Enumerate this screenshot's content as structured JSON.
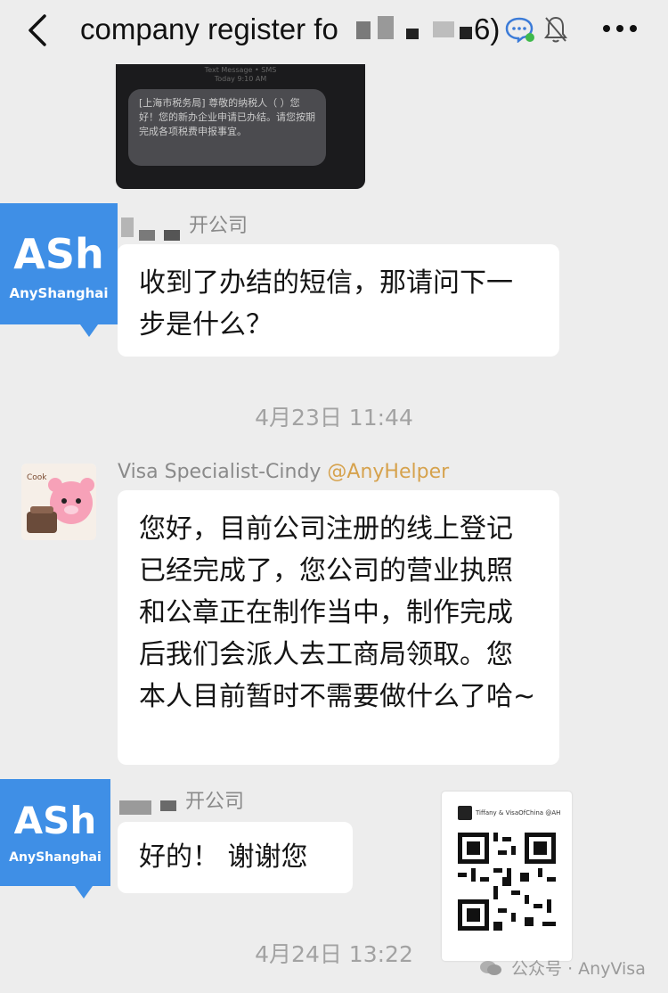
{
  "header": {
    "title": "company register fo",
    "title_end": "6)",
    "icons": [
      "back-icon",
      "chat-icon",
      "mute-bell-icon",
      "more-icon"
    ]
  },
  "sms": {
    "meta_line1": "Text Message • SMS",
    "meta_line2": "Today 9:10 AM",
    "text": "[上海市税务局] 尊敬的纳税人（                ）您好！您的新办企业申请已办结。请您按期完成各项税费申报事宜。"
  },
  "messages": [
    {
      "sender_suffix": "开公司",
      "text": "收到了办结的短信，那请问下一步是什么？",
      "avatar": {
        "logo": "ASh",
        "sub": "AnyShanghai"
      }
    },
    {
      "sender": "Visa Specialist-Cindy",
      "tag": "@AnyHelper",
      "text": "您好，目前公司注册的线上登记已经完成了，您公司的营业执照和公章正在制作当中，制作完成后我们会派人去工商局领取。您本人目前暂时不需要做什么了哈~"
    },
    {
      "sender_suffix": "开公司",
      "text": "好的！ 谢谢您",
      "avatar": {
        "logo": "ASh",
        "sub": "AnyShanghai"
      }
    }
  ],
  "timestamps": {
    "t1": "4月23日 11:44",
    "t2": "4月24日 13:22"
  },
  "qr_card": {
    "name": "Tiffany & VisaOfChina @AH"
  },
  "watermark": {
    "text": "公众号 · AnyVisa"
  },
  "colors": {
    "background": "#ededed",
    "bubble": "#ffffff",
    "ash_brand": "#3f8fe6",
    "mention": "#d6a24d"
  }
}
